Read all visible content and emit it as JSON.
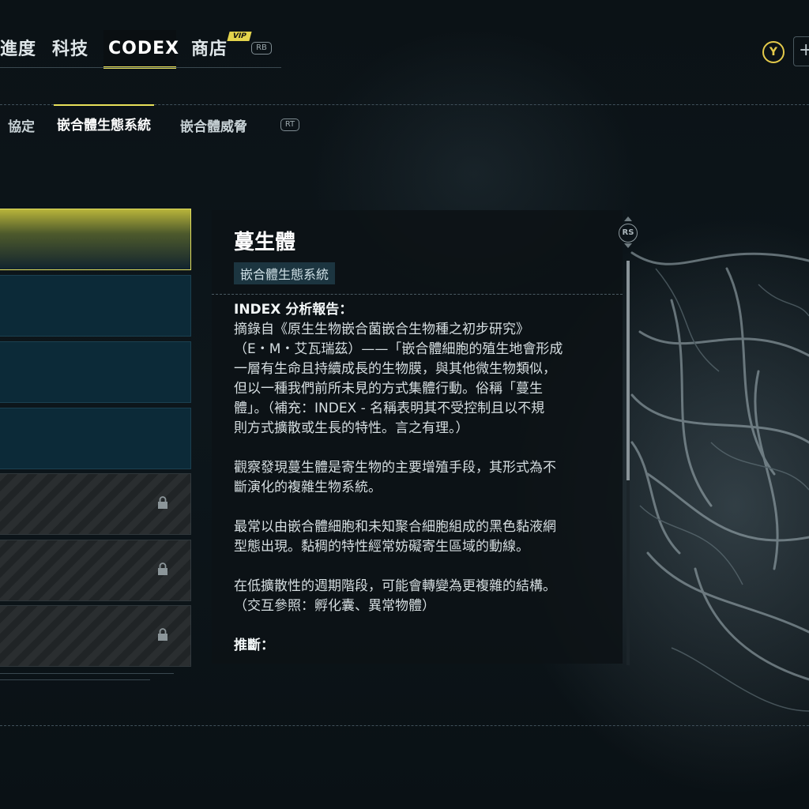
{
  "top_nav": {
    "tabs": [
      {
        "label": "進度"
      },
      {
        "label": "科技"
      },
      {
        "label": "CODEX"
      },
      {
        "label": "商店"
      }
    ],
    "vip_badge": "VIP",
    "rb_label": "RB",
    "y_button": "Y",
    "plus": "+"
  },
  "sub_nav": {
    "tabs": [
      {
        "label": "協定"
      },
      {
        "label": "嵌合體生態系統"
      },
      {
        "label": "嵌合體威脅"
      }
    ],
    "rt_label": "RT"
  },
  "list": {
    "items": [
      {
        "state": "selected"
      },
      {
        "state": "normal"
      },
      {
        "state": "normal"
      },
      {
        "state": "normal"
      },
      {
        "state": "locked"
      },
      {
        "state": "locked"
      },
      {
        "state": "locked"
      }
    ]
  },
  "entry": {
    "title": "蔓生體",
    "category": "嵌合體生態系統",
    "rs_label": "RS",
    "heading": "INDEX 分析報告：",
    "paragraphs": [
      "摘錄自《原生生物嵌合菌嵌合生物種之初步研究》\n（E・M・艾瓦瑞茲）——「嵌合體細胞的殖生地會形成\n一層有生命且持續成長的生物膜，與其他微生物類似，\n但以一種我們前所未見的方式集體行動。俗稱「蔓生\n體」。（補充：INDEX - 名稱表明其不受控制且以不規\n則方式擴散或生長的特性。言之有理。）",
      "觀察發現蔓生體是寄生物的主要增殖手段，其形式為不\n斷演化的複雜生物系統。",
      "最常以由嵌合體細胞和未知聚合細胞組成的黑色黏液網\n型態出現。黏稠的特性經常妨礙寄生區域的動線。",
      "在低擴散性的週期階段，可能會轉變為更複雜的結構。\n（交互參照：孵化囊、異常物體）"
    ],
    "inference_label": "推斷："
  },
  "colors": {
    "accent_yellow": "#e8e05a",
    "panel_bg": "#0c1216",
    "list_normal": "#0c2a38"
  }
}
